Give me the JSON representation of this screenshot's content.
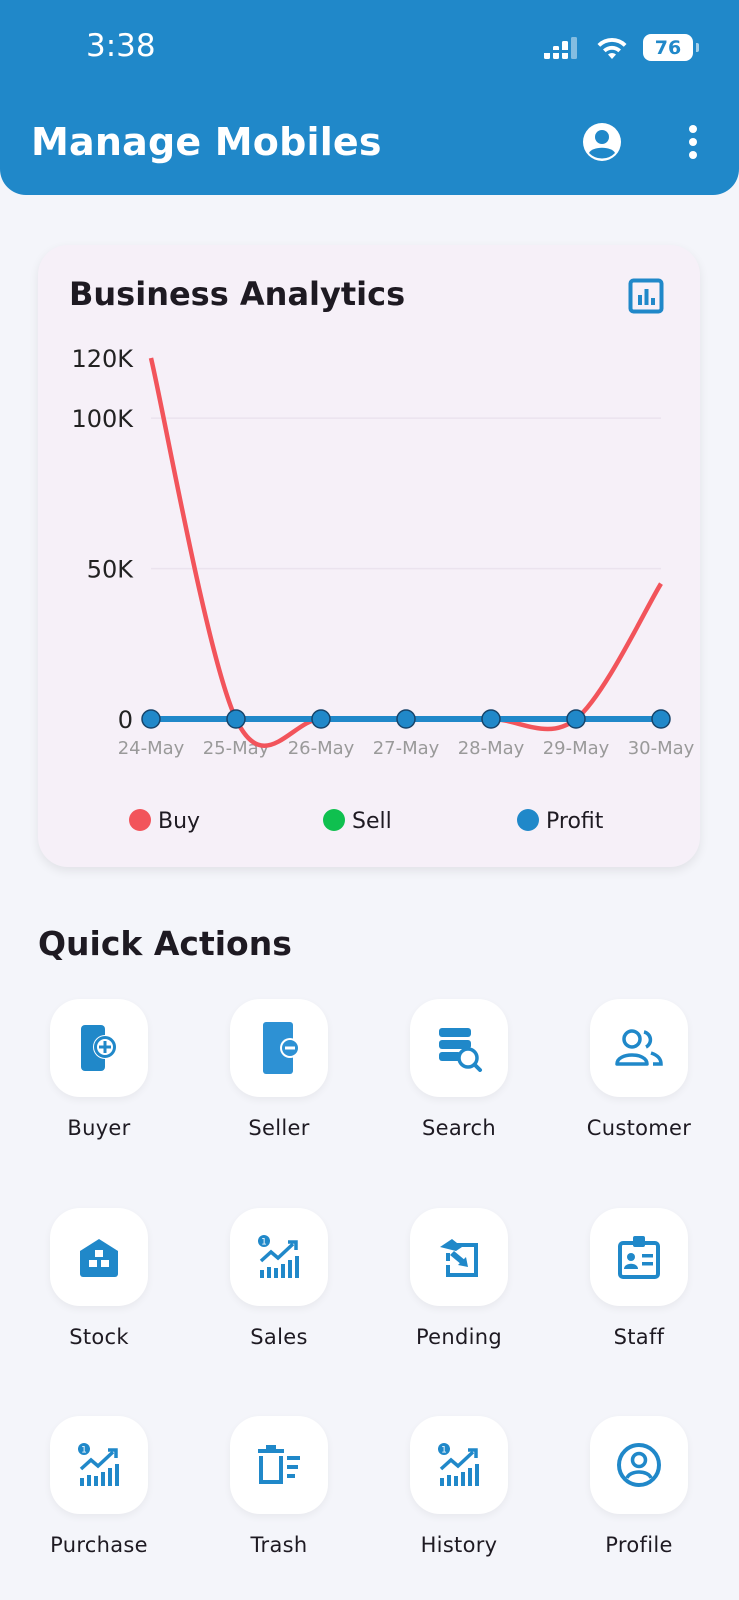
{
  "status_bar": {
    "time": "3:38",
    "battery": "76"
  },
  "header": {
    "title": "Manage Mobiles",
    "icons": [
      "account-circle-icon",
      "more-vert-icon"
    ]
  },
  "analytics": {
    "title": "Business Analytics",
    "icon": "bar-chart-icon"
  },
  "chart_data": {
    "type": "line",
    "title": "Business Analytics",
    "categories": [
      "24-May",
      "25-May",
      "26-May",
      "27-May",
      "28-May",
      "29-May",
      "30-May"
    ],
    "y_ticks": [
      "120K",
      "100K",
      "50K",
      "0"
    ],
    "ylim": [
      0,
      120000
    ],
    "grid": true,
    "legend_position": "bottom",
    "series": [
      {
        "name": "Buy",
        "color": "#f2545b",
        "values": [
          120000,
          0,
          0,
          0,
          0,
          0,
          45000
        ]
      },
      {
        "name": "Sell",
        "color": "#0fc04f",
        "values": [
          0,
          0,
          0,
          0,
          0,
          0,
          0
        ]
      },
      {
        "name": "Profit",
        "color": "#2088c9",
        "values": [
          0,
          0,
          0,
          0,
          0,
          0,
          0
        ]
      }
    ]
  },
  "quick_actions": {
    "title": "Quick Actions",
    "items": [
      {
        "label": "Buyer",
        "icon": "phone-add-icon"
      },
      {
        "label": "Seller",
        "icon": "phone-remove-icon"
      },
      {
        "label": "Search",
        "icon": "database-search-icon"
      },
      {
        "label": "Customer",
        "icon": "people-icon"
      },
      {
        "label": "Stock",
        "icon": "warehouse-icon"
      },
      {
        "label": "Sales",
        "icon": "trending-up-chart-icon"
      },
      {
        "label": "Pending",
        "icon": "pending-box-icon"
      },
      {
        "label": "Staff",
        "icon": "id-badge-icon"
      },
      {
        "label": "Purchase",
        "icon": "trending-up-chart-icon"
      },
      {
        "label": "Trash",
        "icon": "trash-list-icon"
      },
      {
        "label": "History",
        "icon": "trending-up-chart-icon"
      },
      {
        "label": "Profile",
        "icon": "account-circle-icon"
      }
    ]
  }
}
